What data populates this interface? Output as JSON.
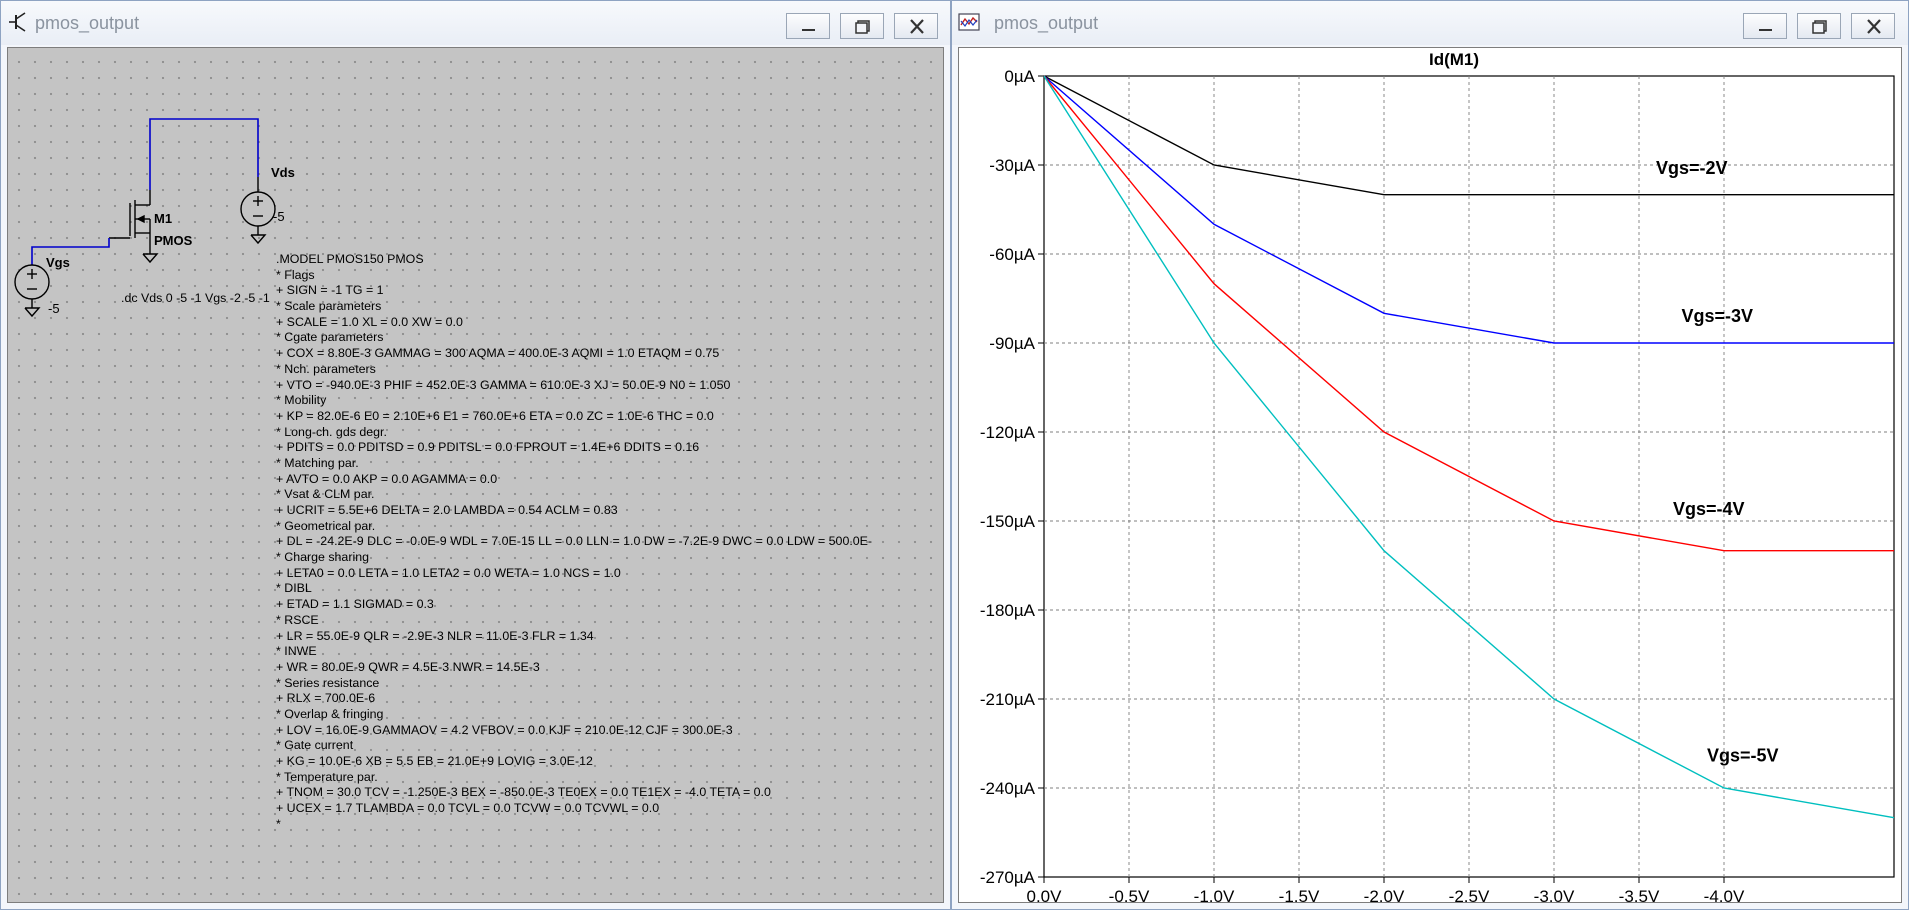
{
  "schematic_window": {
    "title": "pmos_output",
    "components": {
      "m1_name": "M1",
      "m1_model": "PMOS",
      "vds_name": "Vds",
      "vds_value": "-5",
      "vgs_name": "Vgs",
      "vgs_value": "-5"
    },
    "dc_directive": ".dc Vds 0 -5 -1 Vgs -2 -5 -1",
    "spice_model": [
      ".MODEL PMOS150 PMOS",
      "* Flags",
      "+ SIGN = -1 TG = 1",
      "* Scale parameters",
      "+ SCALE = 1.0 XL = 0.0 XW = 0.0",
      "* Cgate parameters",
      "+ COX = 8.80E-3 GAMMAG = 300 AQMA = 400.0E-3 AQMI = 1.0 ETAQM = 0.75",
      "* Nch. parameters",
      "+ VTO = -940.0E-3 PHIF = 452.0E-3 GAMMA = 610.0E-3 XJ = 50.0E-9 N0 = 1.050",
      "* Mobility",
      "+ KP = 82.0E-6 E0 = 2.10E+6 E1 = 760.0E+6 ETA = 0.0 ZC = 1.0E-6 THC = 0.0",
      "* Long-ch. gds degr.",
      "+ PDITS = 0.0 PDITSD = 0.9 PDITSL = 0.0 FPROUT = 1.4E+6 DDITS = 0.16",
      "* Matching par.",
      "+ AVTO = 0.0 AKP = 0.0 AGAMMA = 0.0",
      "* Vsat & CLM par.",
      "+ UCRIT = 5.5E+6 DELTA = 2.0 LAMBDA = 0.54 ACLM = 0.83",
      "* Geometrical par.",
      "+ DL = -24.2E-9 DLC = -0.0E-9 WDL = 7.0E-15 LL = 0.0 LLN = 1.0 DW = -7.2E-9 DWC = 0.0 LDW = 500.0E-",
      "* Charge sharing",
      "+ LETA0 = 0.0 LETA = 1.0 LETA2 = 0.0 WETA = 1.0 NCS = 1.0",
      "* DIBL",
      "+ ETAD = 1.1 SIGMAD = 0.3",
      "* RSCE",
      "+ LR = 55.0E-9 QLR = -2.9E-3 NLR = 11.0E-3 FLR = 1.34",
      "* INWE",
      "+ WR = 80.0E-9 QWR = 4.5E-3 NWR = 14.5E-3",
      "* Series resistance",
      "+ RLX = 700.0E-6",
      "* Overlap & fringing",
      "+ LOV = 16.0E-9 GAMMAOV = 4.2 VFBOV = 0.0 KJF = 210.0E-12 CJF = 300.0E-3",
      "* Gate current",
      "+ KG = 10.0E-6 XB = 5.5 EB = 21.0E+9 LOVIG = 3.0E-12",
      "* Temperature par.",
      "+ TNOM = 30.0 TCV = -1.250E-3 BEX = -850.0E-3 TE0EX = 0.0 TE1EX = -4.0 TETA = 0.0",
      "+ UCEX = 1.7 TLAMBDA = 0.0 TCVL = 0.0 TCVW = 0.0 TCVWL = 0.0",
      "*"
    ]
  },
  "plot_window": {
    "title": "pmos_output"
  },
  "chart_data": {
    "type": "line",
    "title": "Id(M1)",
    "xlabel": "",
    "ylabel": "",
    "x_ticks": [
      "0.0V",
      "-0.5V",
      "-1.0V",
      "-1.5V",
      "-2.0V",
      "-2.5V",
      "-3.0V",
      "-3.5V",
      "-4.0V"
    ],
    "y_ticks": [
      "0µA",
      "-30µA",
      "-60µA",
      "-90µA",
      "-120µA",
      "-150µA",
      "-180µA",
      "-210µA",
      "-240µA",
      "-270µA"
    ],
    "xlim": [
      0,
      -5
    ],
    "ylim": [
      0,
      -270
    ],
    "x_unit": "V",
    "y_unit": "µA",
    "grid": true,
    "series": [
      {
        "name": "Vgs=-2V",
        "color": "#000000",
        "x": [
          0,
          -1,
          -2,
          -3,
          -4,
          -5
        ],
        "values": [
          0,
          -30,
          -40,
          -40,
          -40,
          -40
        ],
        "label_at": [
          -3.6,
          -33
        ]
      },
      {
        "name": "Vgs=-3V",
        "color": "#0000ff",
        "x": [
          0,
          -1,
          -2,
          -3,
          -4,
          -5
        ],
        "values": [
          0,
          -50,
          -80,
          -90,
          -90,
          -90
        ],
        "label_at": [
          -3.75,
          -83
        ]
      },
      {
        "name": "Vgs=-4V",
        "color": "#ff0000",
        "x": [
          0,
          -1,
          -2,
          -3,
          -4,
          -5
        ],
        "values": [
          0,
          -70,
          -120,
          -150,
          -160,
          -160
        ],
        "label_at": [
          -3.7,
          -148
        ]
      },
      {
        "name": "Vgs=-5V",
        "color": "#00bfbf",
        "x": [
          0,
          -1,
          -2,
          -3,
          -4,
          -5
        ],
        "values": [
          0,
          -90,
          -160,
          -210,
          -240,
          -250
        ],
        "label_at": [
          -3.9,
          -231
        ]
      }
    ]
  }
}
